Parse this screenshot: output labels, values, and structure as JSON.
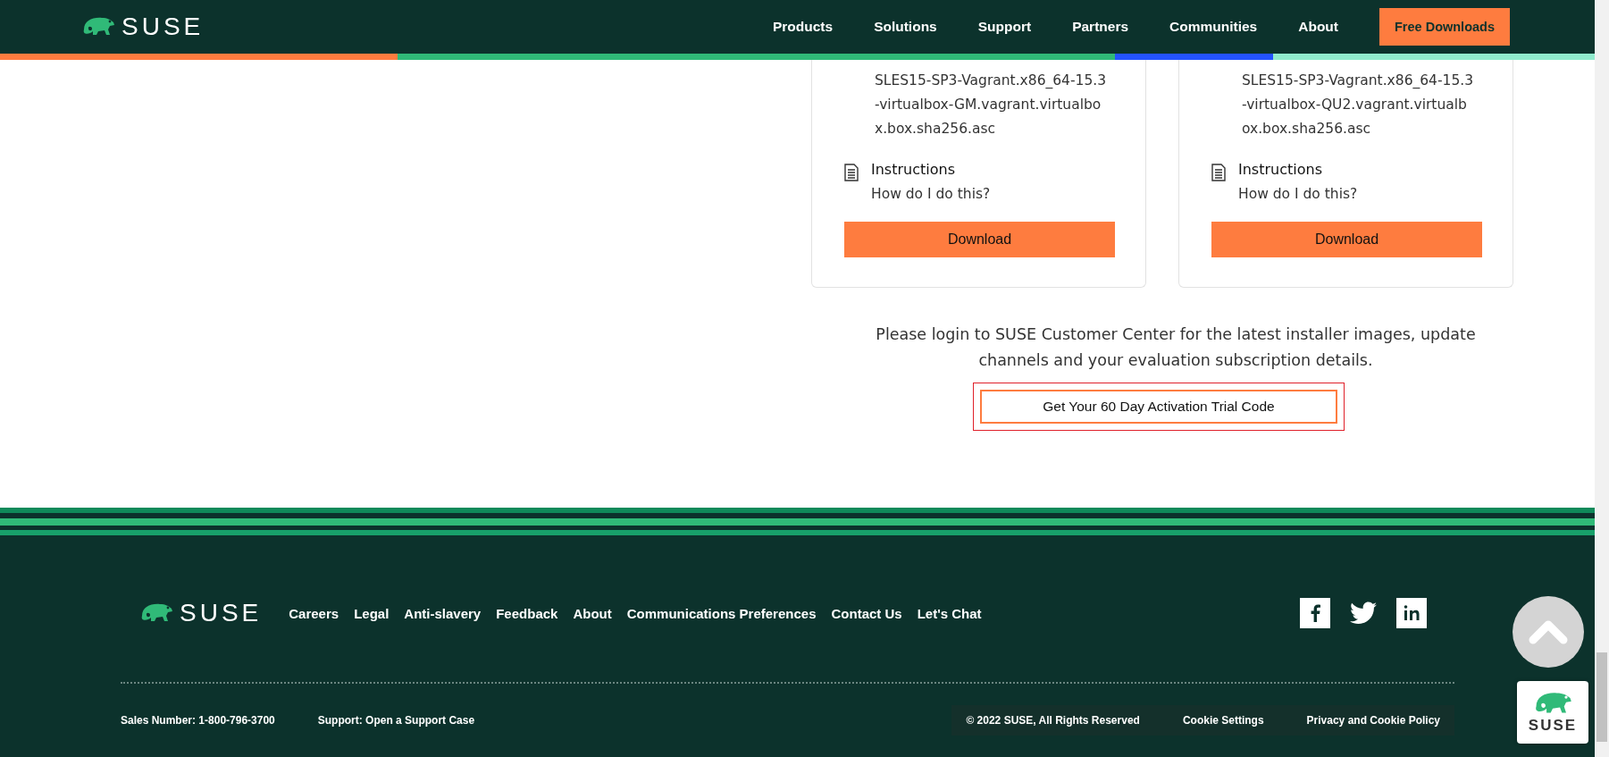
{
  "header": {
    "logo": "SUSE",
    "nav": [
      "Products",
      "Solutions",
      "Support",
      "Partners",
      "Communities",
      "About"
    ],
    "cta": "Free Downloads"
  },
  "cards": [
    {
      "file_lines": [
        "SLES15-SP3-Vagrant.x86_64-15.3",
        "-virtualbox-GM.vagrant.virtualbo",
        "x.box.sha256.asc"
      ],
      "instructions_title": "Instructions",
      "instructions_link": "How do I do this?",
      "button": "Download"
    },
    {
      "file_lines": [
        "SLES15-SP3-Vagrant.x86_64-15.3",
        "-virtualbox-QU2.vagrant.virtualb",
        "ox.box.sha256.asc"
      ],
      "instructions_title": "Instructions",
      "instructions_link": "How do I do this?",
      "button": "Download"
    }
  ],
  "login_note": "Please login to SUSE Customer Center for the latest installer images, update channels and your evaluation subscription details.",
  "trial_button": "Get Your 60 Day Activation Trial Code",
  "footer": {
    "logo": "SUSE",
    "links": [
      "Careers",
      "Legal",
      "Anti-slavery",
      "Feedback",
      "About",
      "Communications Preferences",
      "Contact Us",
      "Let's Chat"
    ],
    "sales": "Sales Number: 1-800-796-3700",
    "support": "Support: Open a Support Case",
    "legal": [
      "© 2022 SUSE, All Rights Reserved",
      "Cookie Settings",
      "Privacy and Cookie Policy"
    ]
  },
  "badge": {
    "logo": "SUSE"
  }
}
